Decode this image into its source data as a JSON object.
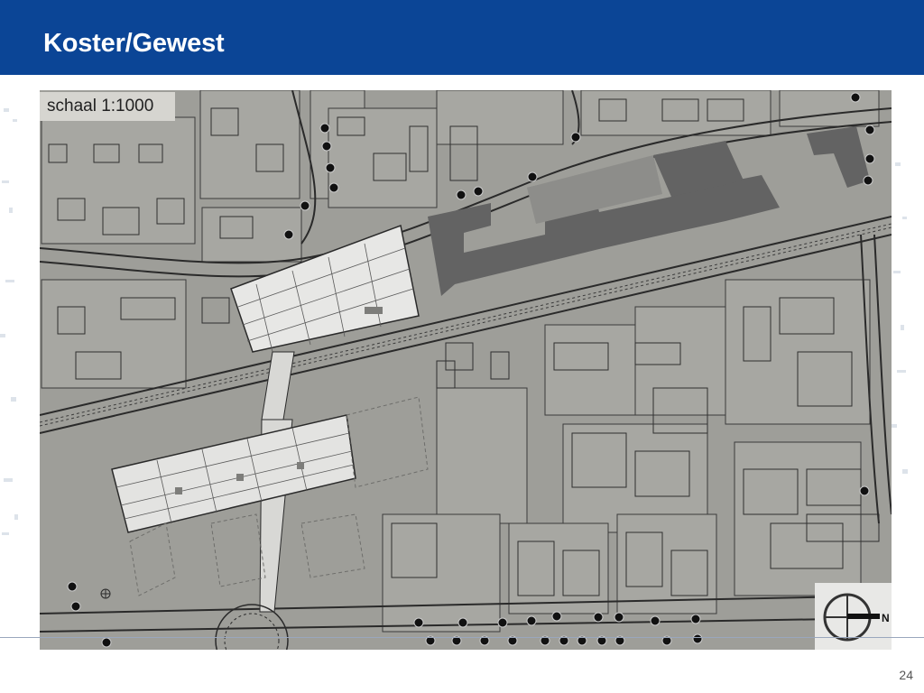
{
  "header": {
    "title": "Koster/Gewest"
  },
  "map": {
    "scale_label": "schaal 1:1000",
    "north_label": "N"
  },
  "footer": {
    "page_number": "24"
  },
  "colors": {
    "header_bg": "#0b4596",
    "map_bg": "#9e9e99",
    "building_dark": "#636363",
    "plot_light": "#a8a8a3"
  }
}
